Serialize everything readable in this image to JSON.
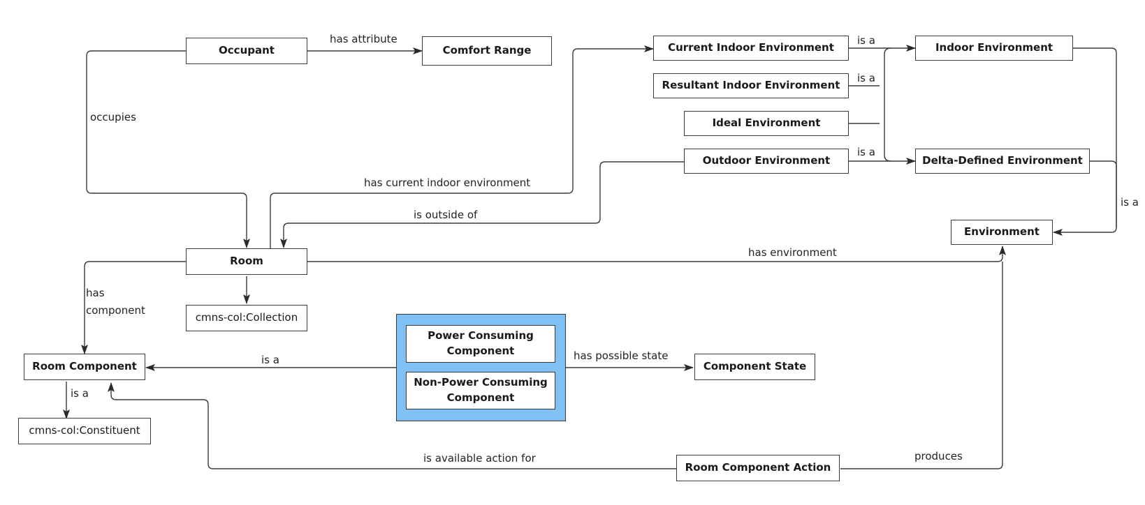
{
  "diagram": {
    "nodes": {
      "occupant": "Occupant",
      "comfort_range": "Comfort Range",
      "current_indoor_environment": "Current Indoor Environment",
      "resultant_indoor_environment": "Resultant Indoor Environment",
      "ideal_environment": "Ideal Environment",
      "outdoor_environment": "Outdoor Environment",
      "indoor_environment": "Indoor Environment",
      "delta_defined_environment": "Delta-Defined Environment",
      "environment": "Environment",
      "room": "Room",
      "collection": "cmns-col:Collection",
      "room_component": "Room Component",
      "constituent": "cmns-col:Constituent",
      "power_consuming_component": "Power Consuming Component",
      "non_power_consuming_component": "Non-Power Consuming Component",
      "component_state": "Component State",
      "room_component_action": "Room Component Action"
    },
    "edge_labels": {
      "has_attribute": "has attribute",
      "occupies": "occupies",
      "has_current_indoor_environment": "has current indoor environment",
      "is_outside_of": "is outside of",
      "is_a_current": "is a",
      "is_a_resultant": "is a",
      "is_a_outdoor": "is a",
      "is_a_environment": "is a",
      "has_environment": "has environment",
      "has_component": "has component",
      "is_a_component_group": "is a",
      "is_a_constituent": "is a",
      "has_possible_state": "has possible state",
      "is_available_action_for": "is available action for",
      "produces": "produces"
    },
    "edges": [
      {
        "from": "occupant",
        "to": "comfort_range",
        "label": "has attribute"
      },
      {
        "from": "occupant",
        "to": "room",
        "label": "occupies"
      },
      {
        "from": "room",
        "to": "current_indoor_environment",
        "label": "has current indoor environment"
      },
      {
        "from": "outdoor_environment",
        "to": "room",
        "label": "is outside of"
      },
      {
        "from": "current_indoor_environment",
        "to": "indoor_environment",
        "label": "is a"
      },
      {
        "from": "resultant_indoor_environment",
        "to": "indoor_environment",
        "label": "is a"
      },
      {
        "from": "ideal_environment",
        "to": "indoor_environment",
        "label": ""
      },
      {
        "from": "outdoor_environment",
        "to": "delta_defined_environment",
        "label": "is a"
      },
      {
        "from": "indoor_environment",
        "to": "environment",
        "label": "is a"
      },
      {
        "from": "delta_defined_environment",
        "to": "environment",
        "label": "is a"
      },
      {
        "from": "room",
        "to": "environment",
        "label": "has environment"
      },
      {
        "from": "room",
        "to": "collection",
        "label": ""
      },
      {
        "from": "room",
        "to": "room_component",
        "label": "has component"
      },
      {
        "from": "component_group",
        "to": "room_component",
        "label": "is a"
      },
      {
        "from": "room_component",
        "to": "constituent",
        "label": "is a"
      },
      {
        "from": "component_group",
        "to": "component_state",
        "label": "has possible state"
      },
      {
        "from": "room_component_action",
        "to": "room_component",
        "label": "is available action for"
      },
      {
        "from": "room_component_action",
        "to": "environment",
        "label": "produces"
      }
    ],
    "colors": {
      "group_fill": "#80c0f4",
      "stroke": "#3a3a3a"
    }
  }
}
